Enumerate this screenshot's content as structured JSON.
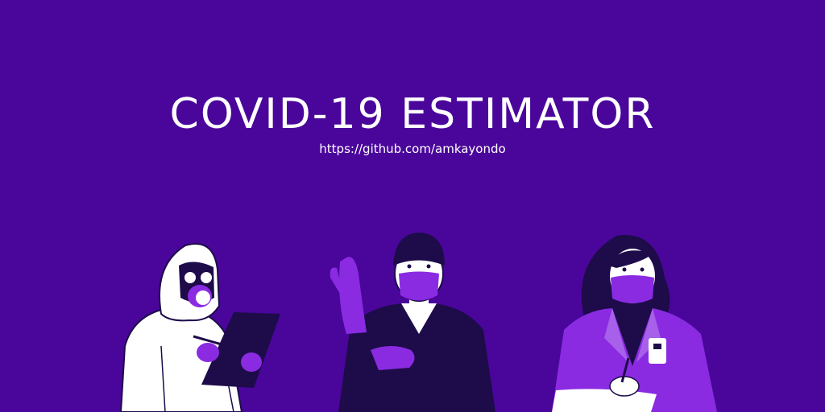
{
  "banner": {
    "title": "COVID-19 ESTIMATOR",
    "subtitle": "https://github.com/amkayondo"
  },
  "colors": {
    "background": "#4a069b",
    "accent": "#8a2be2",
    "dark": "#1e0b4a",
    "white": "#ffffff"
  },
  "illustrations": [
    "hazmat-worker-icon",
    "surgeon-icon",
    "doctor-icon"
  ]
}
